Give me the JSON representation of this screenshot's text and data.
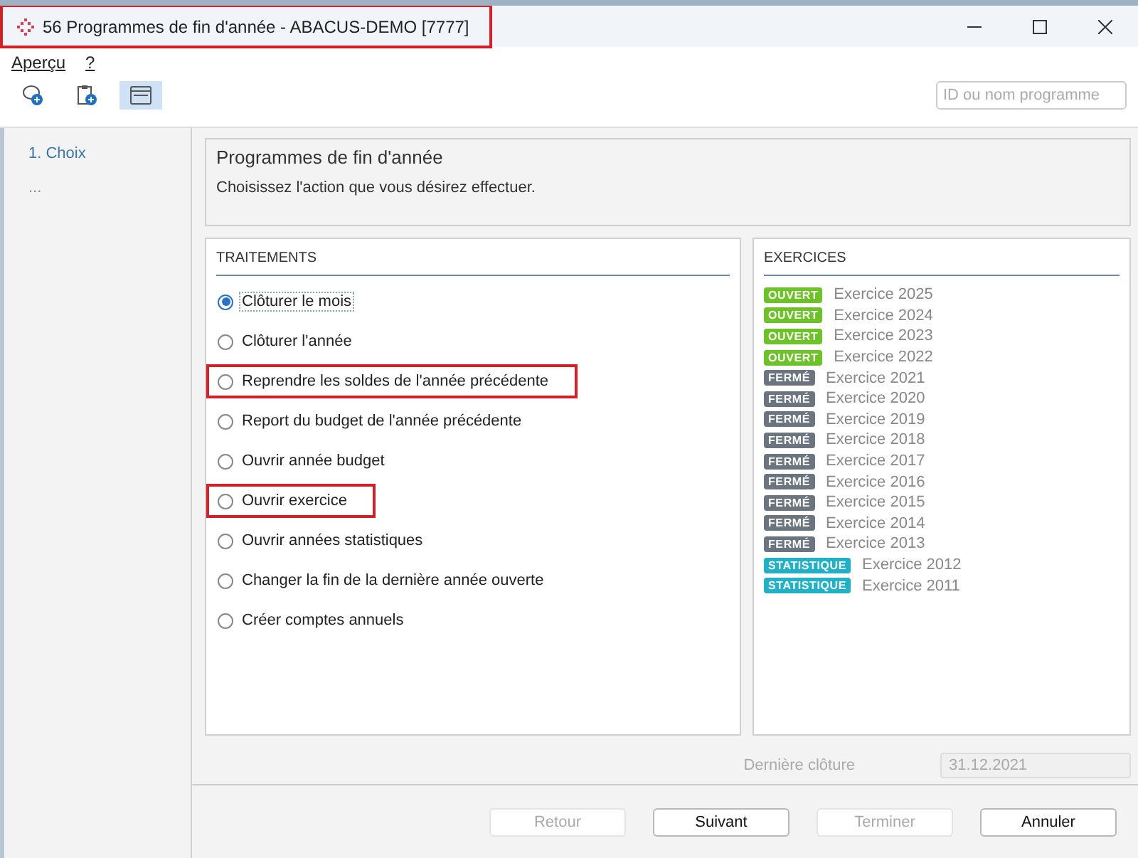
{
  "window": {
    "title": "56 Programmes de fin d'année - ABACUS-DEMO [7777]",
    "title_highlighted": true
  },
  "menu": [
    {
      "label": "Aperçu"
    },
    {
      "label": "?"
    }
  ],
  "toolbar": [
    {
      "kind": "chat",
      "selected": false
    },
    {
      "kind": "clipboard",
      "selected": false
    },
    {
      "kind": "window",
      "selected": true
    }
  ],
  "search": {
    "placeholder": "ID ou nom programme"
  },
  "sidebar": {
    "items": [
      {
        "label": "1. Choix",
        "selected": true
      },
      {
        "label": "...",
        "selected": false
      }
    ]
  },
  "header": {
    "title": "Programmes de fin d'année",
    "subtitle": "Choisissez l'action que vous désirez effectuer."
  },
  "treatments": {
    "title": "TRAITEMENTS",
    "options": [
      {
        "label": "Clôturer le mois",
        "selected": true,
        "highlighted": false
      },
      {
        "label": "Clôturer l'année",
        "selected": false,
        "highlighted": false
      },
      {
        "label": "Reprendre les soldes de l'année précédente",
        "selected": false,
        "highlighted": true
      },
      {
        "label": "Report du budget de l'année précédente",
        "selected": false,
        "highlighted": false
      },
      {
        "label": "Ouvrir année budget",
        "selected": false,
        "highlighted": false
      },
      {
        "label": "Ouvrir exercice",
        "selected": false,
        "highlighted": true
      },
      {
        "label": "Ouvrir années statistiques",
        "selected": false,
        "highlighted": false
      },
      {
        "label": "Changer la fin de la dernière année ouverte",
        "selected": false,
        "highlighted": false
      },
      {
        "label": "Créer comptes annuels",
        "selected": false,
        "highlighted": false
      }
    ]
  },
  "exercises": {
    "title": "EXERCICES",
    "items": [
      {
        "status": "OUVERT",
        "kind": "open",
        "label": "Exercice 2025"
      },
      {
        "status": "OUVERT",
        "kind": "open",
        "label": "Exercice 2024"
      },
      {
        "status": "OUVERT",
        "kind": "open",
        "label": "Exercice 2023"
      },
      {
        "status": "OUVERT",
        "kind": "open",
        "label": "Exercice 2022"
      },
      {
        "status": "FERMÉ",
        "kind": "closed",
        "label": "Exercice 2021"
      },
      {
        "status": "FERMÉ",
        "kind": "closed",
        "label": "Exercice 2020"
      },
      {
        "status": "FERMÉ",
        "kind": "closed",
        "label": "Exercice 2019"
      },
      {
        "status": "FERMÉ",
        "kind": "closed",
        "label": "Exercice 2018"
      },
      {
        "status": "FERMÉ",
        "kind": "closed",
        "label": "Exercice 2017"
      },
      {
        "status": "FERMÉ",
        "kind": "closed",
        "label": "Exercice 2016"
      },
      {
        "status": "FERMÉ",
        "kind": "closed",
        "label": "Exercice 2015"
      },
      {
        "status": "FERMÉ",
        "kind": "closed",
        "label": "Exercice 2014"
      },
      {
        "status": "FERMÉ",
        "kind": "closed",
        "label": "Exercice 2013"
      },
      {
        "status": "STATISTIQUE",
        "kind": "stat",
        "label": "Exercice 2012"
      },
      {
        "status": "STATISTIQUE",
        "kind": "stat",
        "label": "Exercice 2011"
      }
    ]
  },
  "last_close": {
    "label": "Dernière clôture",
    "value": "31.12.2021"
  },
  "buttons": [
    {
      "label": "Retour",
      "disabled": true
    },
    {
      "label": "Suivant",
      "disabled": false
    },
    {
      "label": "Terminer",
      "disabled": true
    },
    {
      "label": "Annuler",
      "disabled": false
    }
  ]
}
